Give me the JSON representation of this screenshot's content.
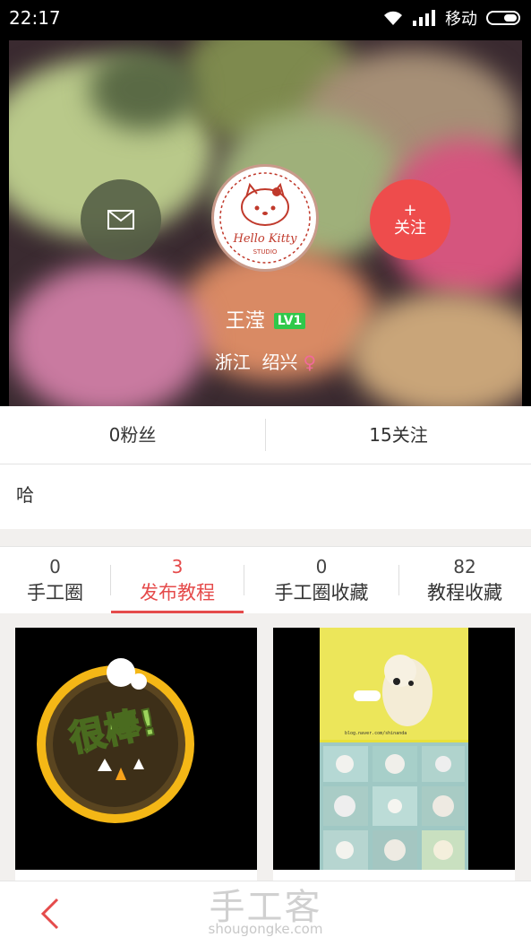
{
  "status_bar": {
    "time": "22:17",
    "carrier": "移动"
  },
  "profile": {
    "name": "王滢",
    "level": "LV1",
    "location": "浙江  绍兴",
    "gender_symbol": "♀",
    "avatar_brand": "Hello Kitty",
    "avatar_sub": "STUDIO"
  },
  "actions": {
    "follow_plus": "+",
    "follow_label": "关注"
  },
  "stats": {
    "fans": "0粉丝",
    "following": "15关注"
  },
  "bio": "哈",
  "tabs": [
    {
      "count": "0",
      "label": "手工圈"
    },
    {
      "count": "3",
      "label": "发布教程"
    },
    {
      "count": "0",
      "label": "手工圈收藏"
    },
    {
      "count": "82",
      "label": "教程收藏"
    }
  ],
  "cards": [
    {
      "badge_text": "很棒!"
    },
    {
      "caption": "blog.naver.com/shinanda"
    }
  ],
  "watermark": {
    "title": "手工客",
    "url": "shougongke.com"
  },
  "colors": {
    "accent": "#e54b4b",
    "level_badge": "#2fc84a",
    "follow_button": "#ee4c4c"
  }
}
